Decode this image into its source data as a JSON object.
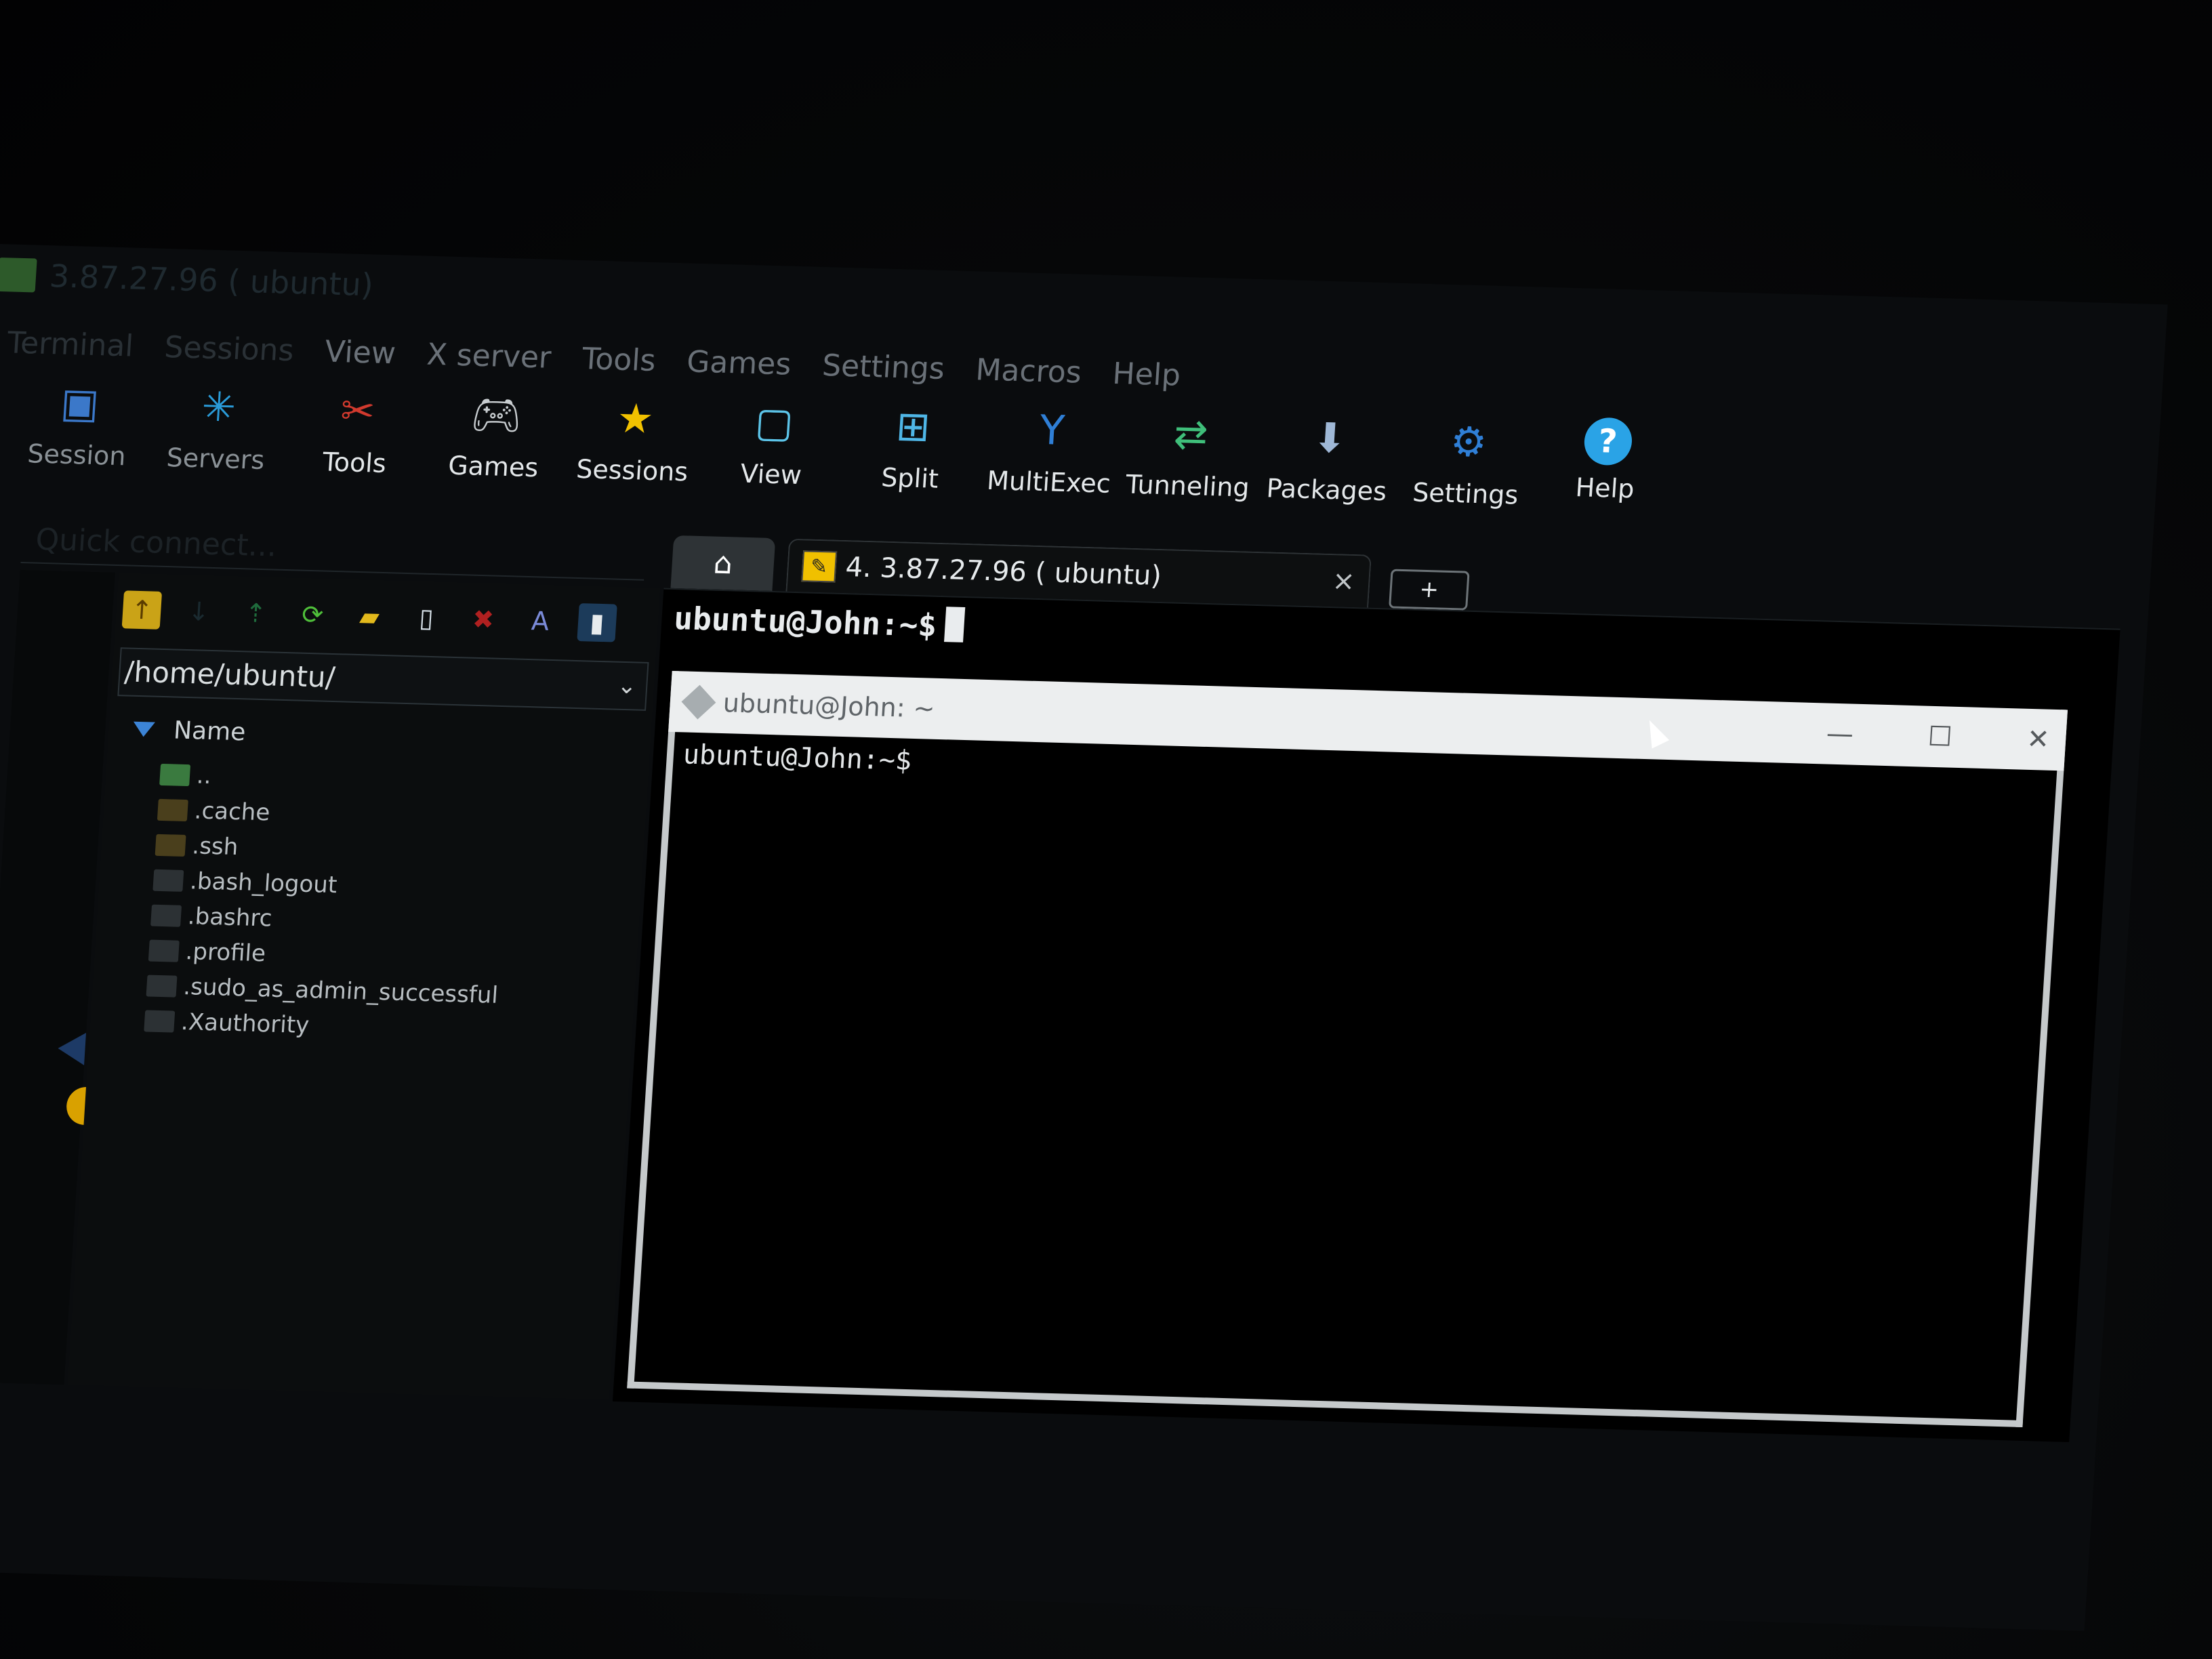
{
  "window": {
    "title": "3.87.27.96 ( ubuntu)"
  },
  "menubar": {
    "items": [
      "Terminal",
      "Sessions",
      "View",
      "X server",
      "Tools",
      "Games",
      "Settings",
      "Macros",
      "Help"
    ]
  },
  "toolbar": {
    "buttons": [
      {
        "label": "Session",
        "icon": "session-icon"
      },
      {
        "label": "Servers",
        "icon": "servers-icon"
      },
      {
        "label": "Tools",
        "icon": "tools-icon"
      },
      {
        "label": "Games",
        "icon": "games-icon"
      },
      {
        "label": "Sessions",
        "icon": "sessions-star-icon"
      },
      {
        "label": "View",
        "icon": "view-icon"
      },
      {
        "label": "Split",
        "icon": "split-icon"
      },
      {
        "label": "MultiExec",
        "icon": "multiexec-icon"
      },
      {
        "label": "Tunneling",
        "icon": "tunneling-icon"
      },
      {
        "label": "Packages",
        "icon": "packages-icon"
      },
      {
        "label": "Settings",
        "icon": "settings-icon"
      },
      {
        "label": "Help",
        "icon": "help-icon"
      }
    ]
  },
  "quick_connect": {
    "placeholder": "Quick connect..."
  },
  "sftp": {
    "path": "/home/ubuntu/",
    "column_header": "Name",
    "files": [
      {
        "name": "..",
        "type": "up"
      },
      {
        "name": ".cache",
        "type": "folder"
      },
      {
        "name": ".ssh",
        "type": "folder"
      },
      {
        "name": ".bash_logout",
        "type": "file"
      },
      {
        "name": ".bashrc",
        "type": "file"
      },
      {
        "name": ".profile",
        "type": "file"
      },
      {
        "name": ".sudo_as_admin_successful",
        "type": "file"
      },
      {
        "name": ".Xauthority",
        "type": "file"
      }
    ]
  },
  "tabs": {
    "session_label": "4. 3.87.27.96 ( ubuntu)",
    "close": "×",
    "new": "+"
  },
  "terminal": {
    "prompt": "ubuntu@John:~$"
  },
  "xwindow": {
    "title": "ubuntu@John: ~",
    "prompt": "ubuntu@John:~$",
    "minimize": "—",
    "maximize": "☐",
    "close": "✕"
  },
  "colors": {
    "accent": "#3c84d6",
    "terminal_bg": "#000000",
    "xwindow_title_bg": "#eceeef"
  }
}
